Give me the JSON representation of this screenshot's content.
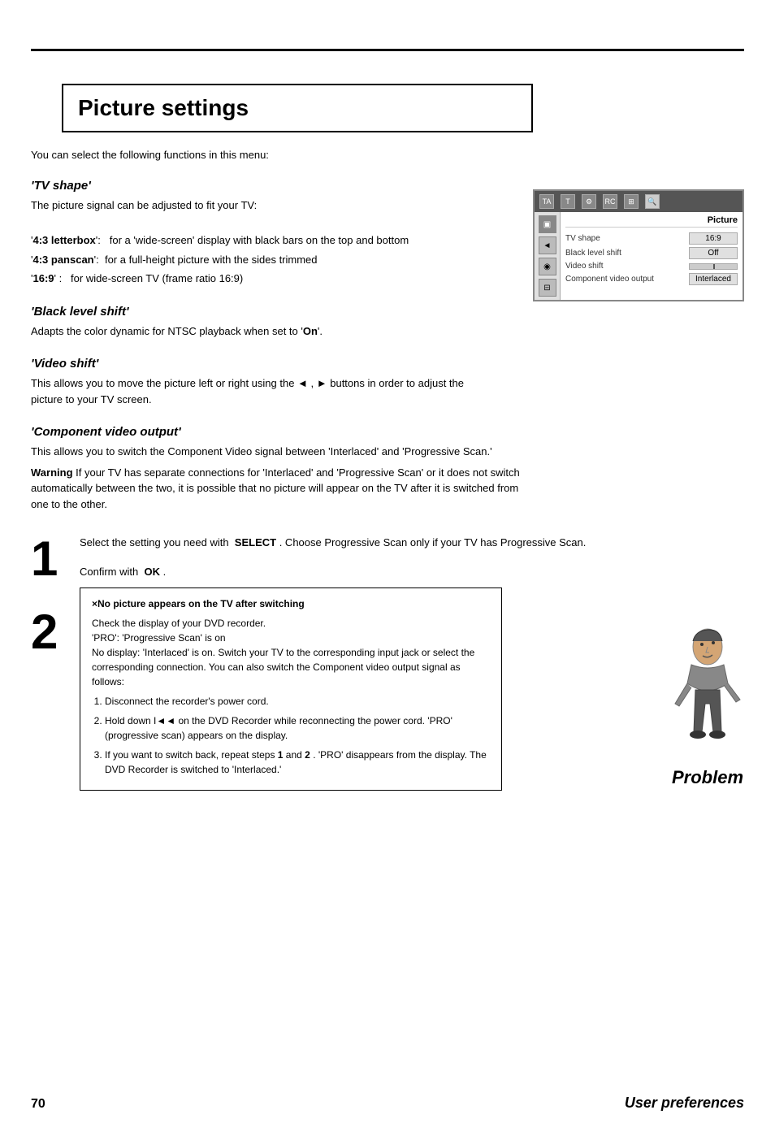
{
  "page": {
    "number": "70",
    "section_label": "User preferences"
  },
  "title": "Picture settings",
  "intro": "You can select the following functions in this menu:",
  "sections": [
    {
      "id": "tv-shape",
      "heading": "'TV shape'",
      "body_lines": [
        "The picture signal can be adjusted to fit your TV:",
        "",
        "'4:3 letterbox':   for a 'wide-screen' display with black bars on the top and bottom",
        "'4:3 panscan':  for a full-height picture with the sides trimmed",
        "'16:9' :   for wide-screen TV (frame ratio 16:9)"
      ]
    },
    {
      "id": "black-level",
      "heading": "'Black level shift'",
      "body_lines": [
        "Adapts the color dynamic for NTSC playback when set to 'On'."
      ]
    },
    {
      "id": "video-shift",
      "heading": "'Video shift'",
      "body_lines": [
        "This allows you to move the picture left or right using the ◄ ,  ► buttons in order to adjust the picture to your TV screen."
      ]
    },
    {
      "id": "component-video",
      "heading": "'Component video output'",
      "body_lines": [
        "This allows you to switch the Component Video signal between 'Interlaced' and 'Progressive Scan.'",
        "Warning If your TV has separate connections for 'Interlaced' and 'Progressive Scan' or it does not switch automatically between the two, it is possible that no picture will appear on the TV after it is switched from one to the other."
      ]
    }
  ],
  "menu_panel": {
    "title": "Picture",
    "rows": [
      {
        "label": "TV shape",
        "value": "16:9",
        "type": "value"
      },
      {
        "label": "Black level shift",
        "value": "Off",
        "type": "value"
      },
      {
        "label": "Video shift",
        "value": "",
        "type": "slider"
      },
      {
        "label": "Component video output",
        "value": "Interlaced",
        "type": "value"
      }
    ]
  },
  "steps": [
    {
      "number": "1",
      "text": "Select the setting you need with  SELECT . Choose Progressive Scan only if your TV has Progressive Scan."
    },
    {
      "number": "2",
      "text": "Confirm with  OK ."
    }
  ],
  "warning_box": {
    "title": "×No picture appears on the TV after switching",
    "intro_lines": [
      "Check the display of your DVD recorder.",
      "'PRO': 'Progressive Scan' is on",
      "No display: 'Interlaced' is on. Switch your TV to the corresponding input jack or select the corresponding connection. You can also switch the Component video output signal as follows:"
    ],
    "items": [
      "Disconnect the recorder's power cord.",
      "Hold down I◄◄ on the DVD Recorder while reconnecting the power cord. 'PRO' (progressive scan) appears on the display.",
      "If you want to switch back, repeat steps 1 and 2 . 'PRO' disappears from the display. The DVD Recorder is switched to 'Interlaced.'"
    ]
  },
  "problem_label": "Problem"
}
